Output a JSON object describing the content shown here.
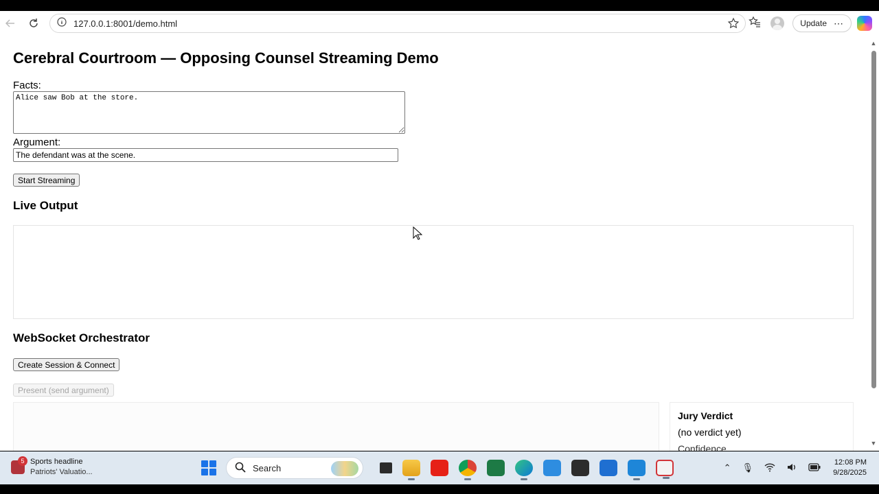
{
  "browser": {
    "url": "127.0.0.1:8001/demo.html",
    "update_label": "Update"
  },
  "page": {
    "title": "Cerebral Courtroom — Opposing Counsel Streaming Demo",
    "facts_label": "Facts:",
    "facts_value": "Alice saw Bob at the store.",
    "argument_label": "Argument:",
    "argument_value": "The defendant was at the scene.",
    "start_button": "Start Streaming",
    "live_output_heading": "Live Output",
    "ws_heading": "WebSocket Orchestrator",
    "connect_button": "Create Session & Connect",
    "present_button": "Present (send argument)",
    "verdict": {
      "title": "Jury Verdict",
      "text": "(no verdict yet)",
      "confidence_label": "Confidence"
    }
  },
  "taskbar": {
    "news_badge": "5",
    "news_title": "Sports headline",
    "news_sub": "Patriots' Valuatio...",
    "search_placeholder": "Search",
    "time": "12:08 PM",
    "date": "9/28/2025"
  },
  "colors": {
    "windows_blue": "#1a73e8",
    "news_red": "#d13438"
  }
}
